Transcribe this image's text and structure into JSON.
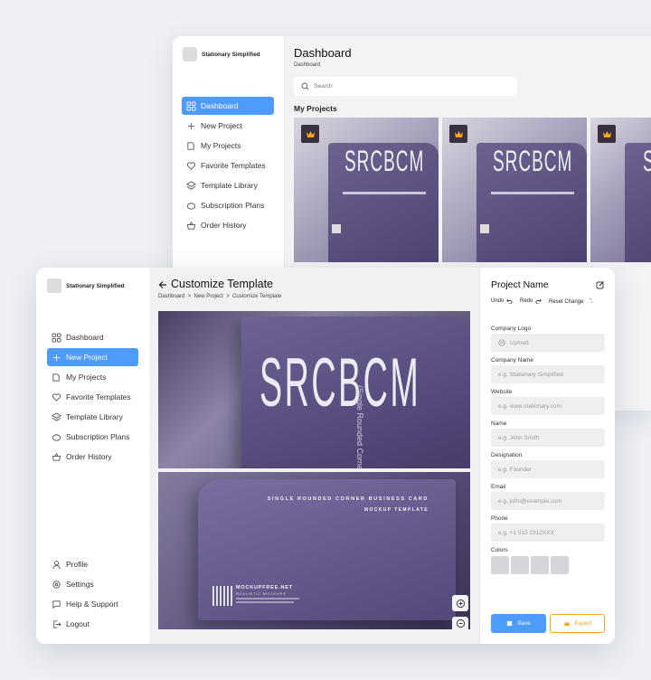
{
  "back_window": {
    "brand": "Stationary Simplified",
    "nav": [
      {
        "label": "Dashboard",
        "icon": "grid-icon",
        "active": true
      },
      {
        "label": "New Project",
        "icon": "plus-icon"
      },
      {
        "label": "My Projects",
        "icon": "folder-icon"
      },
      {
        "label": "Favorite Templates",
        "icon": "heart-icon"
      },
      {
        "label": "Template Library",
        "icon": "layers-icon"
      },
      {
        "label": "Subscription Plans",
        "icon": "piggy-bank-icon"
      },
      {
        "label": "Order History",
        "icon": "basket-icon"
      }
    ],
    "title": "Dashboard",
    "breadcrumb": "Dashboard",
    "search_placeholder": "Search",
    "section_title": "My Projects"
  },
  "front_window": {
    "brand": "Stationary Simplified",
    "nav": [
      {
        "label": "Dashboard",
        "icon": "grid-icon"
      },
      {
        "label": "New Project",
        "icon": "plus-icon",
        "active": true
      },
      {
        "label": "My Projects",
        "icon": "folder-icon"
      },
      {
        "label": "Favorite Templates",
        "icon": "heart-icon"
      },
      {
        "label": "Template Library",
        "icon": "layers-icon"
      },
      {
        "label": "Subscription Plans",
        "icon": "piggy-bank-icon"
      },
      {
        "label": "Order History",
        "icon": "basket-icon"
      }
    ],
    "bottom_nav": [
      {
        "label": "Profile",
        "icon": "user-icon"
      },
      {
        "label": "Settings",
        "icon": "gear-icon"
      },
      {
        "label": "Help & Support",
        "icon": "chat-icon"
      },
      {
        "label": "Logout",
        "icon": "logout-icon"
      }
    ],
    "title": "Customize Template",
    "breadcrumb": [
      "Dashboard",
      "New Project",
      "Customize Template"
    ],
    "card_front": {
      "logo_text": "SRCBCM",
      "vertical_text": "(Single Rounded Corner, Business Card)"
    },
    "card_back": {
      "headline": "SINGLE ROUNDED CORNER BUSINESS CARD",
      "subline": "MOCKUP TEMPLATE",
      "site": "MOCKUPFREE.NET",
      "site_sub": "REALISTIC MOCKUPS"
    },
    "panel": {
      "project_name": "Project Name",
      "undo": "Undo",
      "redo": "Redo",
      "reset": "Reset Change",
      "fields": [
        {
          "label": "Company Logo",
          "placeholder": "Upload",
          "icon": "upload-icon"
        },
        {
          "label": "Company Name",
          "placeholder": "e.g. Stationary Simplified"
        },
        {
          "label": "Website",
          "placeholder": "e.g. www.stationary.com"
        },
        {
          "label": "Name",
          "placeholder": "e.g. John Smith"
        },
        {
          "label": "Designation",
          "placeholder": "e.g. Founder"
        },
        {
          "label": "Email",
          "placeholder": "e.g. john@example.com"
        },
        {
          "label": "Phone",
          "placeholder": "e.g. +1 515 2312XXX"
        }
      ],
      "colors_label": "Colors",
      "save": "Save",
      "export": "Export"
    }
  },
  "colors": {
    "accent": "#4d9bfb",
    "export": "#f5a623",
    "card_purple": "#5b4c80"
  }
}
